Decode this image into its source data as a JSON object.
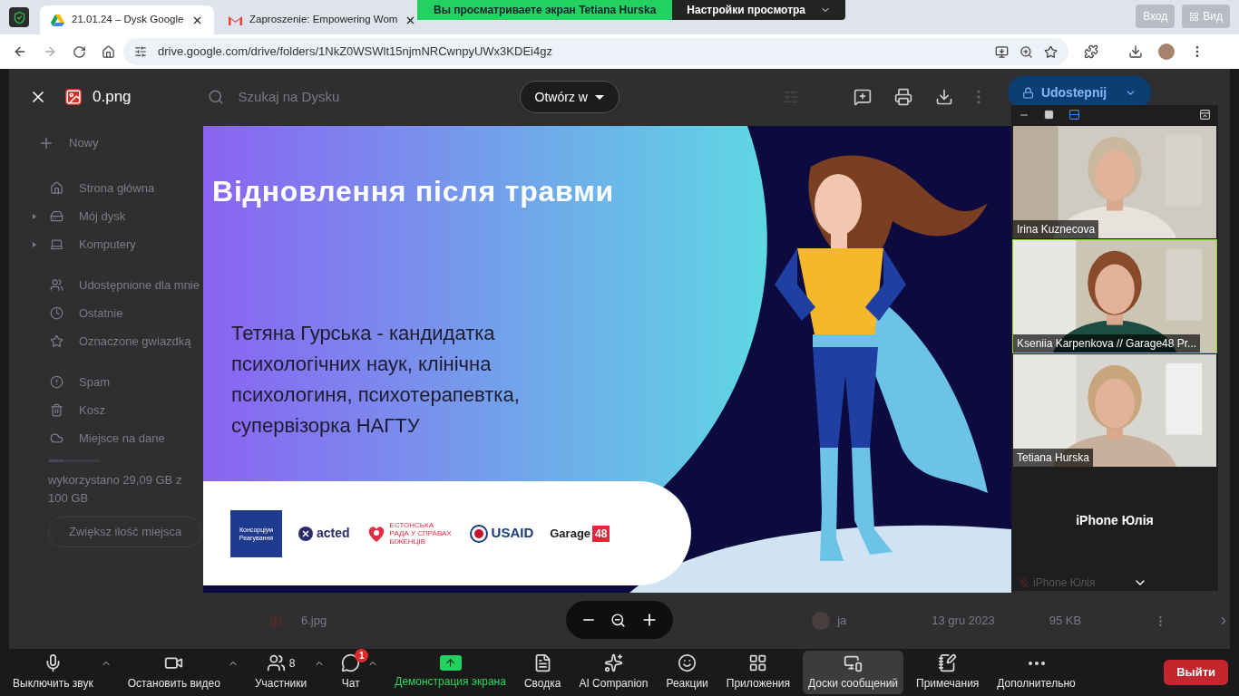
{
  "screen_share_banner": {
    "status": "Вы просматриваете экран Tetiana Hurska",
    "settings": "Настройки просмотра"
  },
  "zoom_top_buttons": [
    "Вход",
    "Вид"
  ],
  "browser": {
    "tabs": [
      {
        "title": "21.01.24 – Dysk Google",
        "selected": true
      },
      {
        "title": "Zaproszenie: Empowering Wom",
        "selected": false
      }
    ],
    "url": "drive.google.com/drive/folders/1NkZ0WSWlt15njmNRCwnpyUWx3KDEi4gz"
  },
  "drive": {
    "file_name": "0.png",
    "search_placeholder": "Szukaj na Dysku",
    "open_with": "Otwórz w",
    "share": "Udostepnij",
    "new": "Nowy",
    "sidebar_groups": [
      [
        {
          "label": "Strona główna",
          "expandable": false
        },
        {
          "label": "Mój dysk",
          "expandable": true
        },
        {
          "label": "Komputery",
          "expandable": true
        }
      ],
      [
        {
          "label": "Udostępnione dla mnie",
          "expandable": false
        },
        {
          "label": "Ostatnie",
          "expandable": false
        },
        {
          "label": "Oznaczone gwiazdką",
          "expandable": false
        }
      ],
      [
        {
          "label": "Spam",
          "expandable": false
        },
        {
          "label": "Kosz",
          "expandable": false
        },
        {
          "label": "Miejsce na dane",
          "expandable": false
        }
      ]
    ],
    "storage": {
      "text": "wykorzystano 29,09 GB z 100 GB",
      "level": 0.29
    },
    "upgrade": "Zwiększ ilość miejsca",
    "file_row": {
      "name": "6.jpg",
      "owner": "ja",
      "date": "13 gru 2023",
      "size": "95 KB"
    }
  },
  "slide": {
    "title": "Відновлення після травми",
    "body": "Тетяна Гурська - кандидатка психологічних наук, клінічна психологиня, психотерапевтка, супервізорка НАГТУ",
    "logos": [
      {
        "kind": "consortium",
        "text": "Консорціум Реагування"
      },
      {
        "kind": "acted",
        "text": "acted"
      },
      {
        "kind": "council",
        "text": "ЕСТОНСЬКА РАДА У СПРАВАХ БІЖЕНЦІВ"
      },
      {
        "kind": "usaid",
        "text": "USAID"
      },
      {
        "kind": "garage",
        "text": "Garage",
        "badge": "48"
      }
    ]
  },
  "video_panel": {
    "tiles": [
      {
        "kind": "camera",
        "name": "Irina Kuznecova",
        "active_speaker": false
      },
      {
        "kind": "camera",
        "name": "Kseniia Karpenkova // Garage48 Pr...",
        "active_speaker": true
      },
      {
        "kind": "camera",
        "name": "Tetiana Hurska",
        "active_speaker": false
      },
      {
        "kind": "no_video",
        "name": "iPhone Юлія",
        "active_speaker": false
      }
    ],
    "footer_name": "iPhone Юлія"
  },
  "toolbar": {
    "items": [
      {
        "kind": "button",
        "label": "Выключить звук",
        "menu": true,
        "selected": false
      },
      {
        "kind": "button",
        "label": "Остановить видео",
        "menu": true,
        "selected": false
      },
      {
        "kind": "button",
        "label": "Участники",
        "menu": true,
        "selected": false,
        "count": "8"
      },
      {
        "kind": "button",
        "label": "Чат",
        "menu": true,
        "selected": false,
        "badge": "1"
      },
      {
        "kind": "share",
        "label": "Демонстрация экрана",
        "menu": false,
        "selected": false
      },
      {
        "kind": "button",
        "label": "Сводка",
        "menu": false,
        "selected": false
      },
      {
        "kind": "button",
        "label": "AI Companion",
        "menu": false,
        "selected": false
      },
      {
        "kind": "button",
        "label": "Реакции",
        "menu": false,
        "selected": false
      },
      {
        "kind": "button",
        "label": "Приложения",
        "menu": false,
        "selected": false
      },
      {
        "kind": "button",
        "label": "Доски сообщений",
        "menu": false,
        "selected": true
      },
      {
        "kind": "button",
        "label": "Примечания",
        "menu": false,
        "selected": false
      },
      {
        "kind": "button",
        "label": "Дополнительно",
        "menu": false,
        "selected": false
      }
    ],
    "leave": "Выйти"
  }
}
